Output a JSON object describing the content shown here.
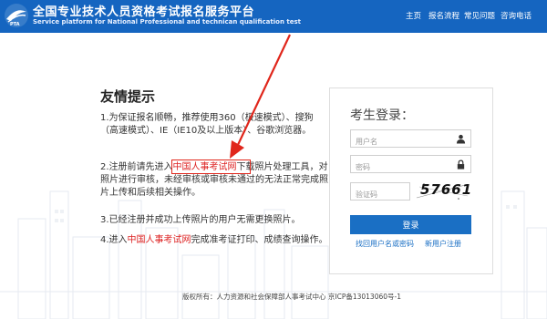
{
  "header": {
    "title_cn": "全国专业技术人员资格考试报名服务平台",
    "title_en": "Service platform for National Professional and technican qualification test",
    "nav": [
      "主页",
      "报名流程",
      "常见问题",
      "咨询电话"
    ],
    "bg_color": "#1565c0"
  },
  "tips": {
    "title": "友情提示",
    "tip1": "1.为保证报名顺畅，推荐使用360（极速模式）、搜狗（高速模式）、IE（IE10及以上版本）、谷歌浏览器。",
    "tip2_pre": "2.注册前请先进入",
    "tip2_link": "中国人事考试网",
    "tip2_post": "下载照片处理工具，对照片进行审核，未经审核或审核未通过的无法正常完成照片上传和后续相关操作。",
    "tip3": "3.已经注册并成功上传照片的用户无需更换照片。",
    "tip4_pre": "4.进入",
    "tip4_link": "中国人事考试网",
    "tip4_post": "完成准考证打印、成绩查询操作。"
  },
  "login": {
    "title": "考生登录：",
    "username_placeholder": "用户名",
    "password_placeholder": "密码",
    "captcha_placeholder": "验证码",
    "captcha_text": "57661",
    "login_button": "登录",
    "forgot_link": "找回用户名或密码",
    "register_link": "新用户注册"
  },
  "footer": {
    "text": "版权所有：人力资源和社会保障部人事考试中心 京ICP备13013060号-1"
  }
}
